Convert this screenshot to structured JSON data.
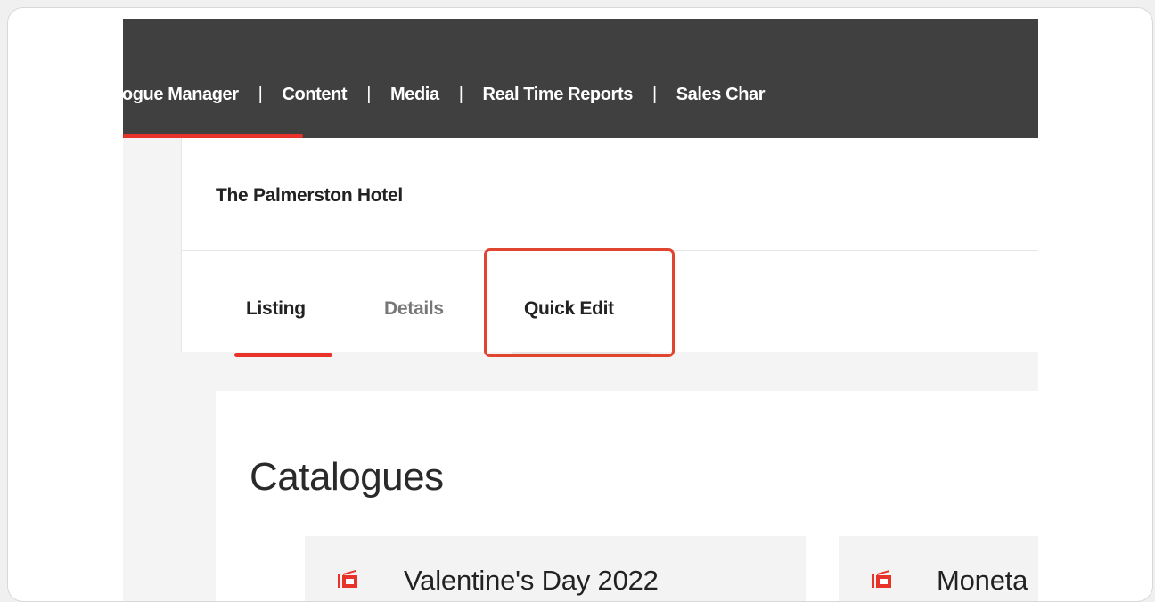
{
  "topnav": {
    "items": [
      {
        "label": "alogue Manager"
      },
      {
        "label": "Content"
      },
      {
        "label": "Media"
      },
      {
        "label": "Real Time Reports"
      },
      {
        "label": "Sales Char"
      }
    ],
    "separator": "|",
    "active_color": "#e8332a",
    "background": "#404040"
  },
  "property": {
    "title": "The Palmerston Hotel"
  },
  "tabs": [
    {
      "label": "Listing",
      "active": true
    },
    {
      "label": "Details",
      "active": false
    },
    {
      "label": "Quick Edit",
      "active": false,
      "highlighted": true
    }
  ],
  "catalogues": {
    "heading": "Catalogues",
    "items": [
      {
        "label": "Valentine's Day 2022",
        "icon": "catalogue-icon"
      },
      {
        "label": "Moneta",
        "icon": "catalogue-icon"
      }
    ]
  },
  "colors": {
    "accent": "#e8332a",
    "highlight_box": "#e0452f"
  }
}
